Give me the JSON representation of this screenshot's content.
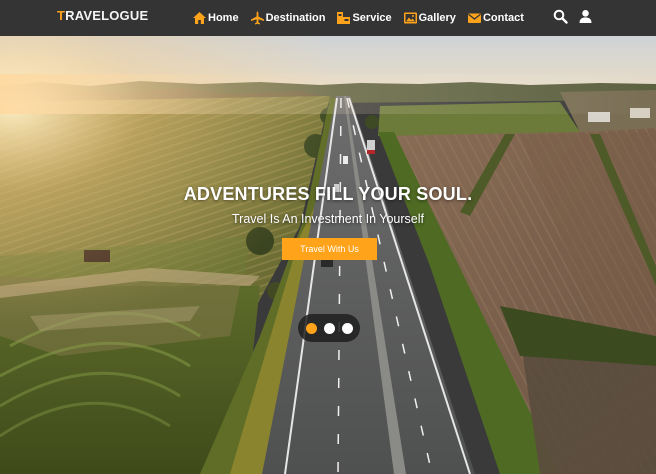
{
  "brand": {
    "first_letter": "T",
    "rest": "RAVELOGUE",
    "accent_color": "#ffa31a",
    "navbar_color": "#343434"
  },
  "nav": {
    "items": [
      {
        "label": "Home",
        "icon": "home-icon"
      },
      {
        "label": "Destination",
        "icon": "plane-icon"
      },
      {
        "label": "Service",
        "icon": "service-icon"
      },
      {
        "label": "Gallery",
        "icon": "gallery-icon"
      },
      {
        "label": "Contact",
        "icon": "envelope-icon"
      }
    ],
    "right_icons": [
      "search-icon",
      "user-icon"
    ]
  },
  "hero": {
    "title": "ADVENTURES FILL YOUR SOUL.",
    "subtitle": "Travel Is An Investment In Yourself",
    "button_label": "Travel With Us",
    "background": "aerial-highway-farmland-sunset-photo"
  },
  "carousel": {
    "slide_count": 3,
    "active_index": 0
  }
}
